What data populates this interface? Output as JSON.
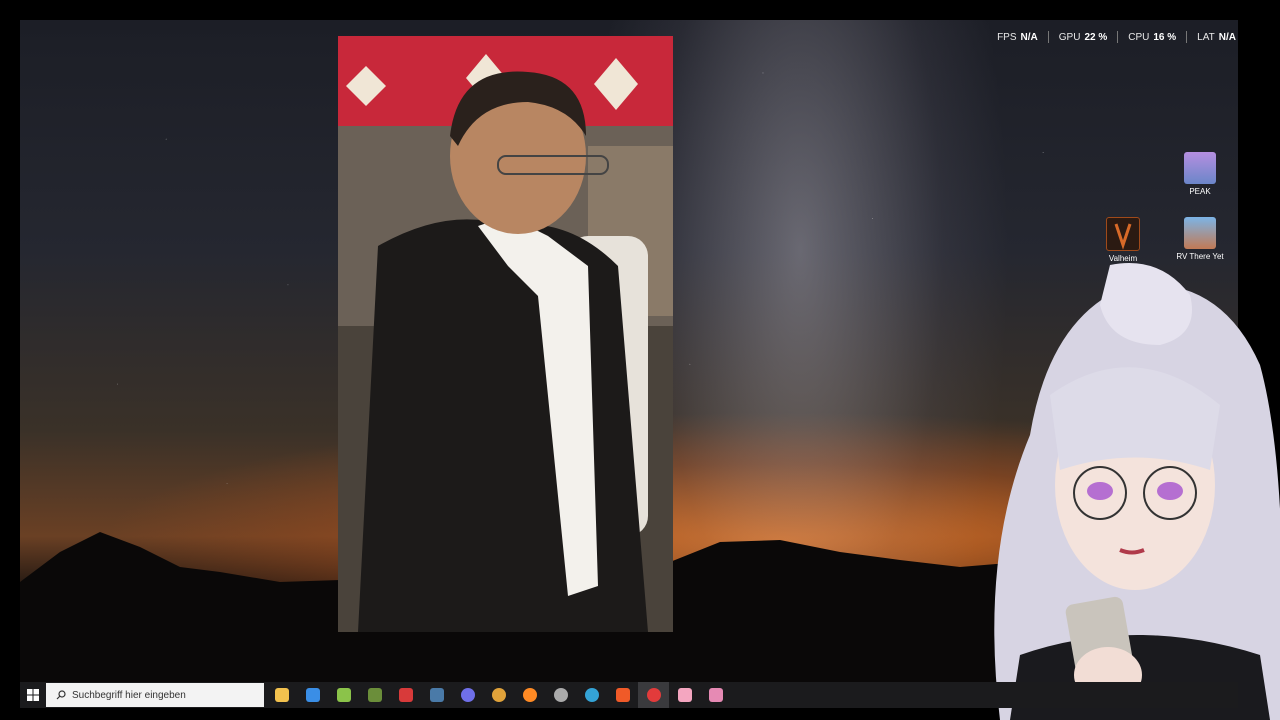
{
  "overlay": {
    "fps_label": "FPS",
    "fps_value": "N/A",
    "gpu_label": "GPU",
    "gpu_value": "22 %",
    "cpu_label": "CPU",
    "cpu_value": "16 %",
    "lat_label": "LAT",
    "lat_value": "N/A"
  },
  "desktop_icons": [
    {
      "label": "PEAK",
      "icon": "peak-game-icon",
      "color": "#6b86c9"
    },
    {
      "label": "Valheim",
      "icon": "valheim-game-icon",
      "color": "#a04a1a"
    },
    {
      "label": "RV There Yet",
      "icon": "rv-there-yet-game-icon",
      "color": "#c27a55"
    }
  ],
  "taskbar": {
    "search_placeholder": "Suchbegriff hier eingeben",
    "apps": [
      {
        "name": "file-explorer-icon",
        "color": "#f2c14e"
      },
      {
        "name": "store-icon",
        "color": "#3a8ee6"
      },
      {
        "name": "android-app-icon",
        "color": "#8bc34a"
      },
      {
        "name": "minecraft-icon",
        "color": "#6b8e3a"
      },
      {
        "name": "medal-app-icon",
        "color": "#d83a3a"
      },
      {
        "name": "steam-icon",
        "color": "#4a7aa8"
      },
      {
        "name": "discord-icon",
        "color": "#6f6fe8"
      },
      {
        "name": "chrome-icon",
        "color": "#e0a23a"
      },
      {
        "name": "firefox-icon",
        "color": "#ff8a24"
      },
      {
        "name": "speedometer-icon",
        "color": "#aaaaaa"
      },
      {
        "name": "sync-app-icon",
        "color": "#34a3d6"
      },
      {
        "name": "brave-icon",
        "color": "#f05a28"
      },
      {
        "name": "streaming-app-icon",
        "color": "#e23b3b"
      },
      {
        "name": "vtuber-app-icon",
        "color": "#f4a6c0"
      },
      {
        "name": "pink-app-icon",
        "color": "#e68ab4"
      }
    ]
  }
}
